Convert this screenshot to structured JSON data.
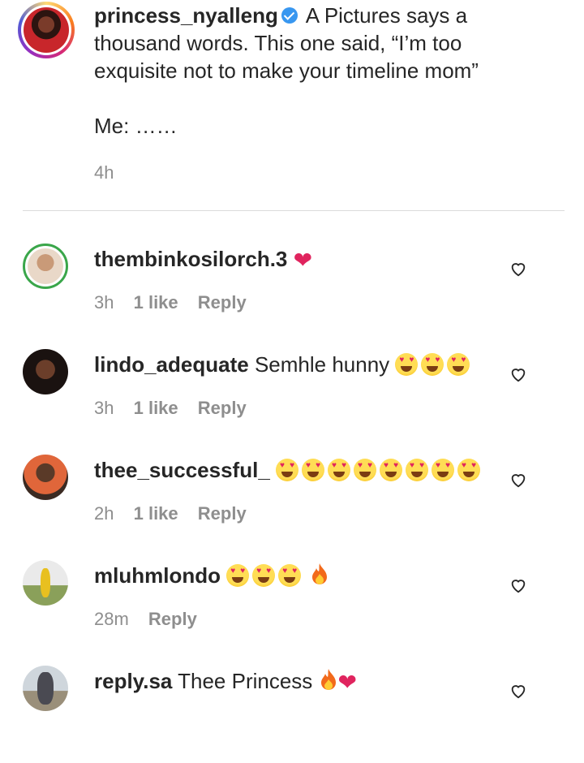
{
  "post": {
    "username": "princess_nyalleng",
    "caption_line1": "A Pictures says a",
    "caption_line2": "thousand words. This one said, “I’m too",
    "caption_line3": "exquisite not to make your timeline mom”",
    "caption_line4": "Me: ……",
    "time": "4h"
  },
  "comments": [
    {
      "username": "thembinkosilorch.3",
      "text": "",
      "time": "3h",
      "likes": "1 like",
      "reply": "Reply"
    },
    {
      "username": "lindo_adequate",
      "text": "Semhle hunny",
      "time": "3h",
      "likes": "1 like",
      "reply": "Reply"
    },
    {
      "username": "thee_successful_",
      "text": "",
      "time": "2h",
      "likes": "1 like",
      "reply": "Reply"
    },
    {
      "username": "mluhmlondo",
      "text": "",
      "time": "28m",
      "likes": "",
      "reply": "Reply"
    },
    {
      "username": "reply.sa",
      "text": "Thee Princess",
      "time": "",
      "likes": "",
      "reply": ""
    }
  ],
  "colors": {
    "verified": "#3897f0",
    "heart": "#e0245e",
    "meta": "#8e8e8e",
    "text": "#262626"
  },
  "icons": [
    "verified-badge-icon",
    "like-heart-icon",
    "heart-eyes-emoji",
    "fire-emoji",
    "red-heart-emoji"
  ]
}
